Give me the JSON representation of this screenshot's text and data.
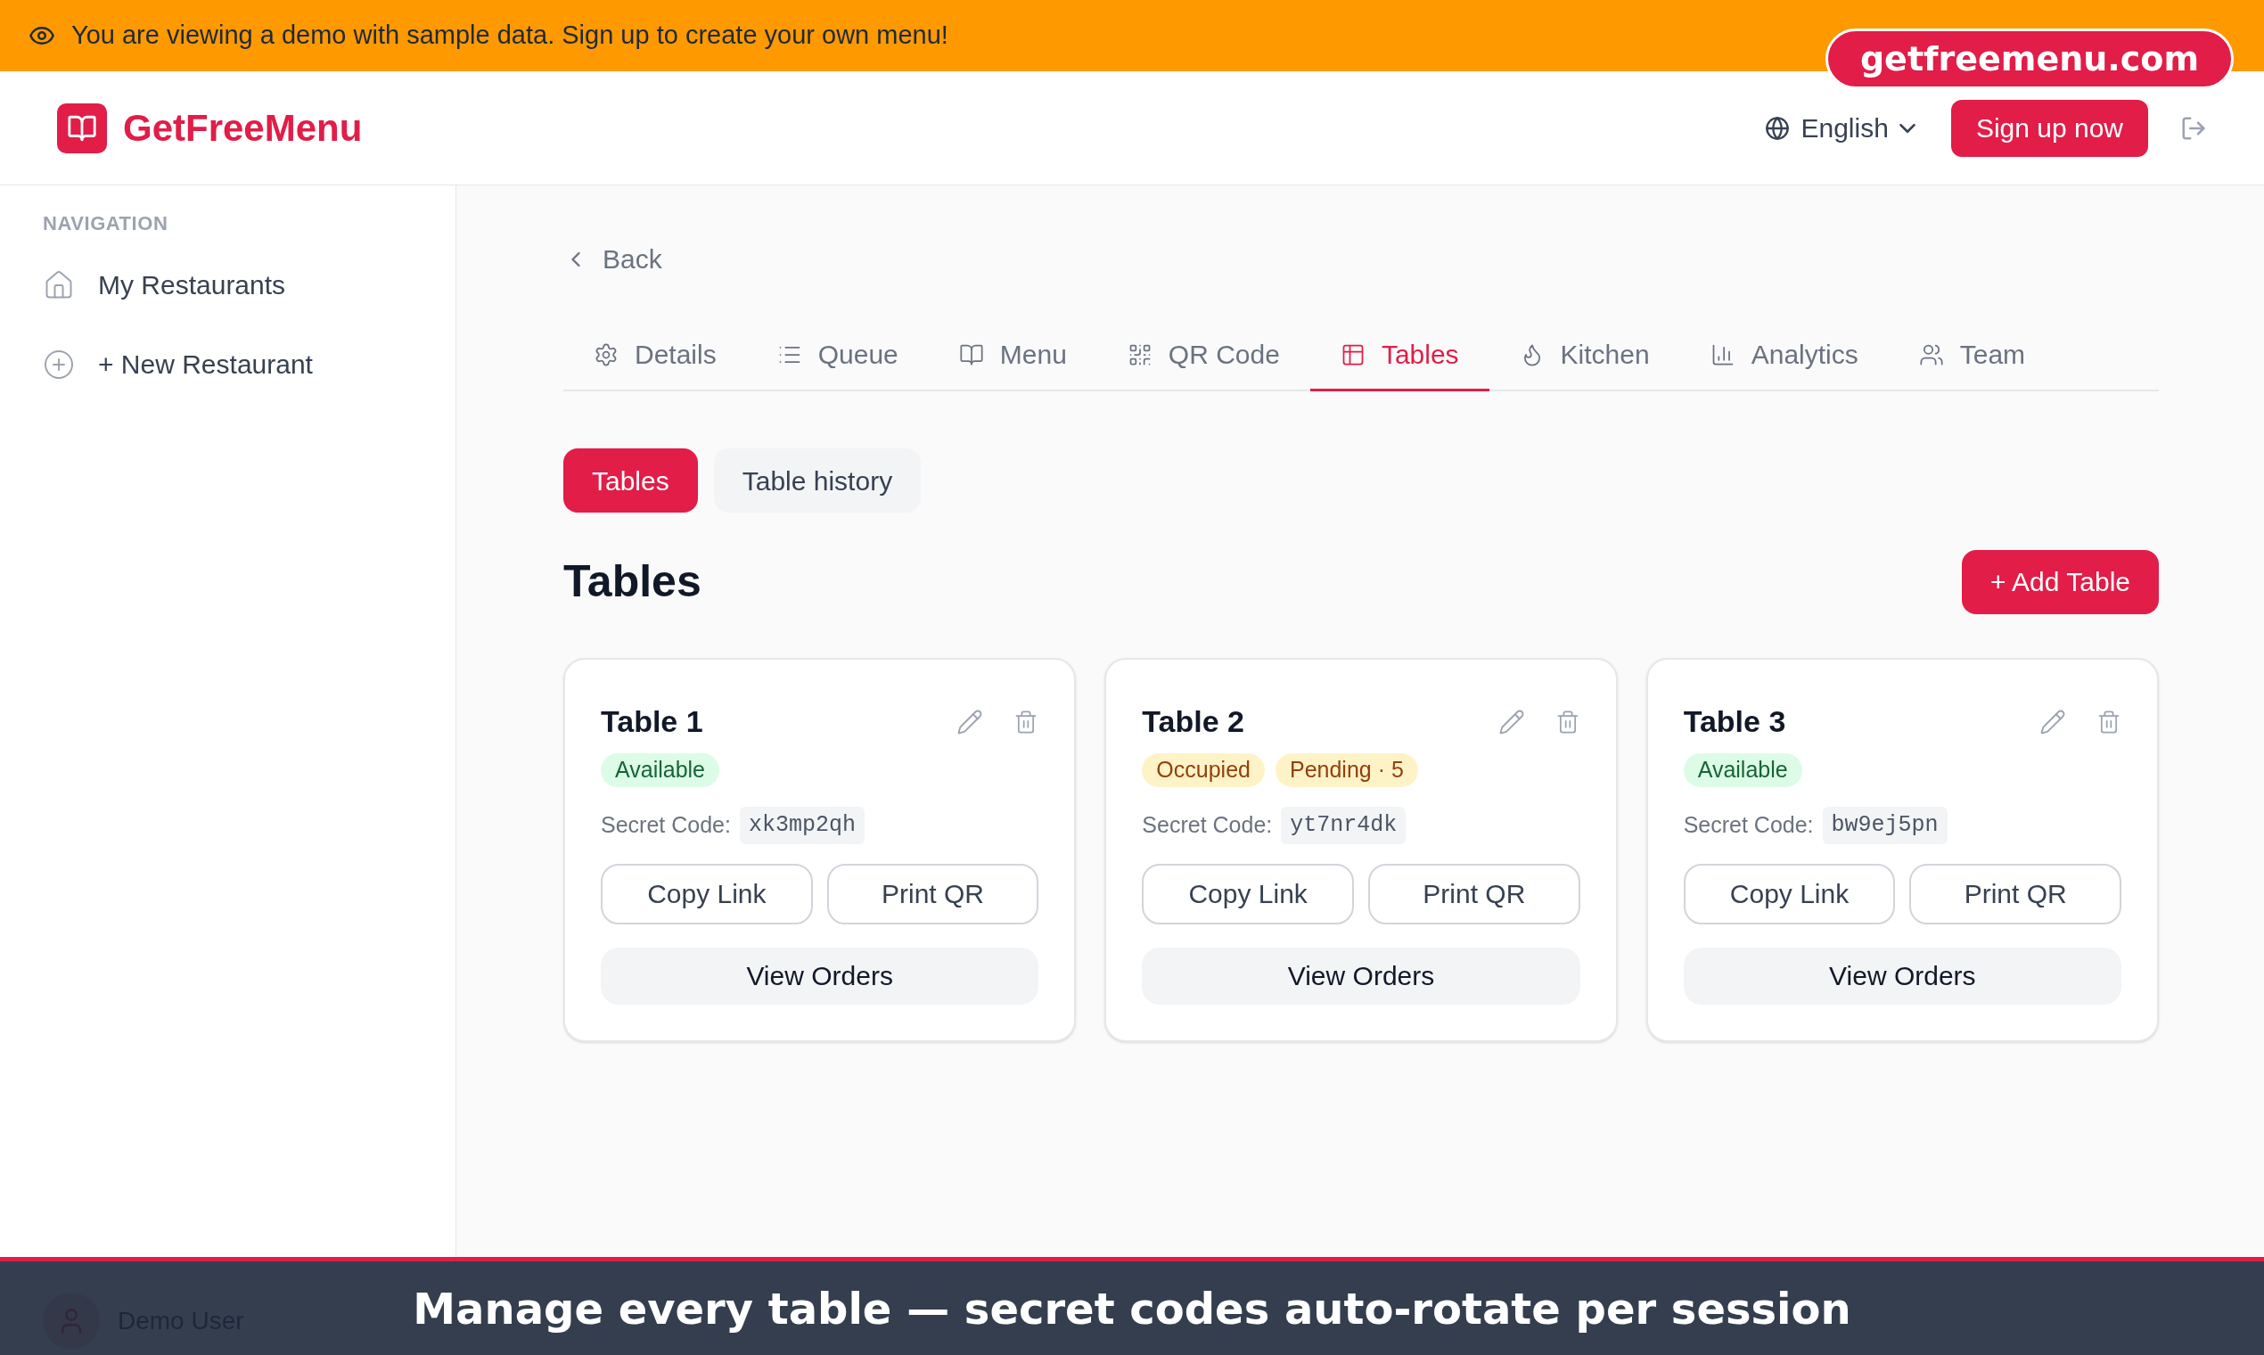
{
  "demo_banner": {
    "text": "You are viewing a demo with sample data. Sign up to create your own menu!"
  },
  "site_badge": "getfreemenu.com",
  "header": {
    "logo": "GetFreeMenu",
    "language": "English",
    "signup_button": "Sign up now"
  },
  "sidebar": {
    "heading": "NAVIGATION",
    "items": [
      {
        "label": "My Restaurants",
        "kind": "home"
      },
      {
        "label": "+ New Restaurant",
        "kind": "add"
      }
    ],
    "user": "Demo User"
  },
  "back_link": "Back",
  "tabs": [
    {
      "label": "Details",
      "kind": "gear",
      "selected": false
    },
    {
      "label": "Queue",
      "kind": "list",
      "selected": false
    },
    {
      "label": "Menu",
      "kind": "book",
      "selected": false
    },
    {
      "label": "QR Code",
      "kind": "qr",
      "selected": false
    },
    {
      "label": "Tables",
      "kind": "table",
      "selected": true
    },
    {
      "label": "Kitchen",
      "kind": "flame",
      "selected": false
    },
    {
      "label": "Analytics",
      "kind": "chart",
      "selected": false
    },
    {
      "label": "Team",
      "kind": "users",
      "selected": false
    }
  ],
  "subtabs": [
    {
      "label": "Tables",
      "selected": true
    },
    {
      "label": "Table history",
      "selected": false
    }
  ],
  "section_title": "Tables",
  "add_button": "+ Add Table",
  "tables": [
    {
      "name": "Table 1",
      "tags": [
        {
          "text": "Available",
          "color": "#166534"
        }
      ],
      "code_label": "Secret Code:",
      "code": "xk3mp2qh",
      "actions": [
        "Copy Link",
        "Print QR"
      ],
      "view_button": "View Orders"
    },
    {
      "name": "Table 2",
      "tags": [
        {
          "text": "Occupied",
          "color": "#92400e"
        },
        {
          "text": "Pending · 5",
          "color": "#92400e"
        }
      ],
      "code_label": "Secret Code:",
      "code": "yt7nr4dk",
      "actions": [
        "Copy Link",
        "Print QR"
      ],
      "view_button": "View Orders"
    },
    {
      "name": "Table 3",
      "tags": [
        {
          "text": "Available",
          "color": "#166534"
        }
      ],
      "code_label": "Secret Code:",
      "code": "bw9ej5pn",
      "actions": [
        "Copy Link",
        "Print QR"
      ],
      "view_button": "View Orders"
    }
  ],
  "caption": "Manage every table — secret codes auto-rotate per session"
}
